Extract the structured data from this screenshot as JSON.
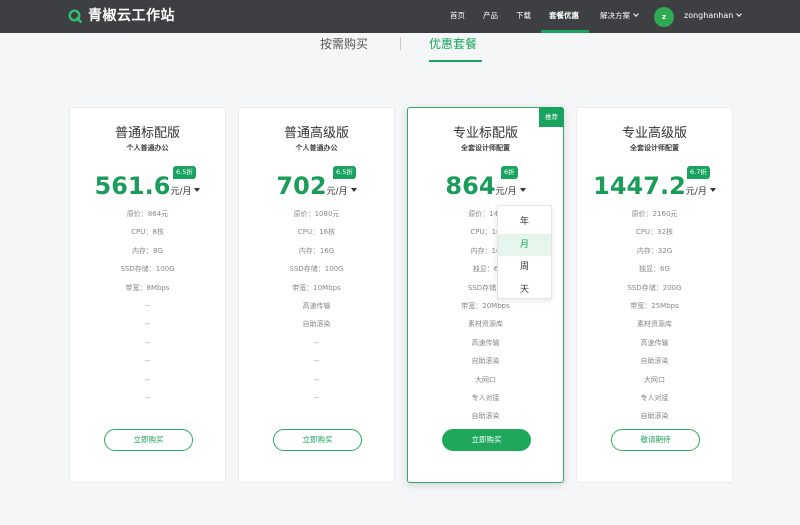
{
  "header": {
    "brand": "青椒云工作站",
    "nav": [
      {
        "label": "首页"
      },
      {
        "label": "产品"
      },
      {
        "label": "下载"
      },
      {
        "label": "套餐优惠"
      },
      {
        "label": "解决方案"
      }
    ],
    "active_nav": "套餐优惠",
    "user": {
      "avatar_letter": "z",
      "name": "zonghanhan"
    }
  },
  "tabs": [
    {
      "label": "按需购买"
    },
    {
      "label": "优惠套餐"
    }
  ],
  "active_tab": "优惠套餐",
  "colors": {
    "accent": "#1aa35e",
    "header_bg": "#3d3f42",
    "price": "#1a9d5a"
  },
  "plans": [
    {
      "title": "普通标配版",
      "subtitle": "个人普通办公",
      "price": "561.6",
      "unit": "元/月",
      "discount": "6.5折",
      "features": [
        "原价：864元",
        "CPU：8核",
        "内存：8G",
        "SSD存储：100G",
        "带宽：8Mbps",
        "--",
        "--",
        "--",
        "--",
        "--",
        "--"
      ],
      "cta": "立即购买"
    },
    {
      "title": "普通高级版",
      "subtitle": "个人普通办公",
      "price": "702",
      "unit": "元/月",
      "discount": "6.5折",
      "features": [
        "原价：1080元",
        "CPU：16核",
        "内存：16G",
        "SSD存储：100G",
        "带宽：10Mbps",
        "高速传输",
        "自助滚染",
        "--",
        "--",
        "--",
        "--"
      ],
      "cta": "立即购买"
    },
    {
      "title": "专业标配版",
      "subtitle": "全套设计师配置",
      "price": "864",
      "unit": "元/月",
      "discount": "6折",
      "badge": "推荐",
      "features": [
        "原价：144",
        "CPU：16",
        "内存：16",
        "独显：6",
        "SSD存储：",
        "带宽：20Mbps",
        "素材资源库",
        "高速传输",
        "自助滚染",
        "大网口",
        "专人对接",
        "自助滚染"
      ],
      "cta": "立即购买"
    },
    {
      "title": "专业高级版",
      "subtitle": "全套设计师配置",
      "price": "1447.2",
      "unit": "元/月",
      "discount": "6.7折",
      "features": [
        "原价：2160元",
        "CPU：32核",
        "内存：32G",
        "独显：6G",
        "SSD存储：200G",
        "带宽：25Mbps",
        "素材资源库",
        "高速传输",
        "自助滚染",
        "大网口",
        "专人对接",
        "自助滚染"
      ],
      "cta": "敬请期待"
    }
  ],
  "period_dropdown": {
    "options": [
      "年",
      "月",
      "周",
      "天"
    ],
    "selected": "月"
  }
}
